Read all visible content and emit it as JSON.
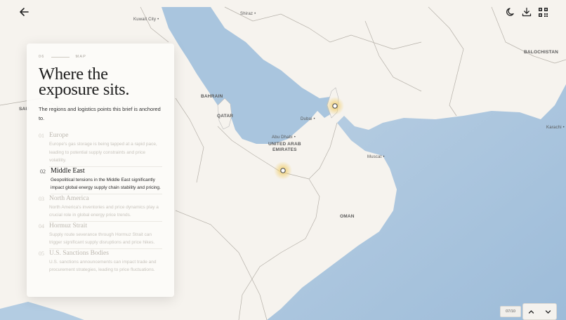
{
  "header": {
    "back_icon": "arrow-left-icon",
    "theme_icon": "moon-icon",
    "download_icon": "download-icon",
    "qr_icon": "qr-code-icon"
  },
  "panel": {
    "section_number": "06",
    "section_label": "MAP",
    "title_line1": "Where the",
    "title_line2": "exposure sits.",
    "subtitle": "The regions and logistics points this brief is anchored to.",
    "items": [
      {
        "number": "01",
        "name": "Europe",
        "description": "Europe's gas storage is being tapped at a rapid pace, leading to potential supply constraints and price volatility."
      },
      {
        "number": "02",
        "name": "Middle East",
        "description": "Geopolitical tensions in the Middle East significantly impact global energy supply chain stability and pricing."
      },
      {
        "number": "03",
        "name": "North America",
        "description": "North America's inventories and price dynamics play a crucial role in global energy price trends."
      },
      {
        "number": "04",
        "name": "Hormuz Strait",
        "description": "Supply route severance through Hormuz Strait can trigger significant supply disruptions and price hikes."
      },
      {
        "number": "05",
        "name": "U.S. Sanctions Bodies",
        "description": "U.S. sanctions announcements can impact trade and procurement strategies, leading to price fluctuations."
      }
    ],
    "active_index": 1
  },
  "map": {
    "labels": {
      "kuwait_city": "Kuwait City",
      "shiraz": "Shiraz",
      "balochistan": "BALOCHISTAN",
      "bahrain": "BAHRAIN",
      "qatar": "QATAR",
      "dubai": "Dubai",
      "abu_dhabi": "Abu Dhabi",
      "uae_line1": "UNITED ARAB",
      "uae_line2": "EMIRATES",
      "muscat": "Muscat",
      "karachi": "Karachi",
      "oman": "OMAN",
      "sau": "SAU"
    },
    "colors": {
      "land": "#f6f3ee",
      "water": "#a9c5de",
      "marker": "#e8c06a"
    }
  },
  "pagination": {
    "text": "07/10",
    "up_icon": "chevron-up-icon",
    "down_icon": "chevron-down-icon"
  }
}
